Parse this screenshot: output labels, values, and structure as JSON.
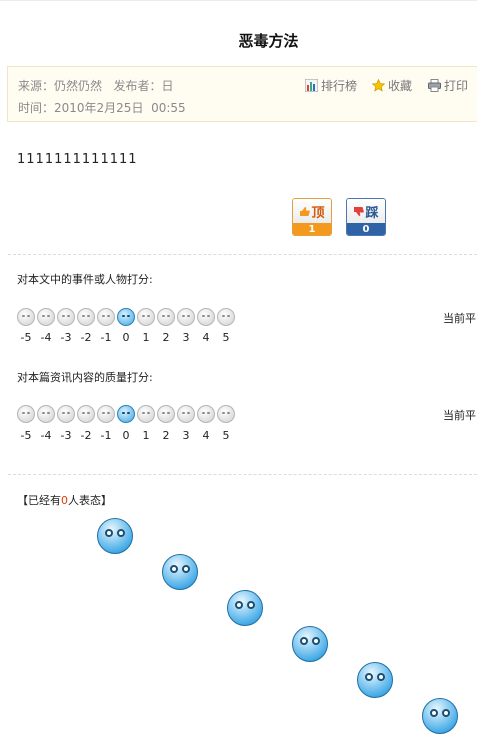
{
  "article": {
    "title": "恶毒方法",
    "meta_line1": "来源：仍然仍然   发布者：日",
    "meta_line2": "时间：2010年2月25日  00:55",
    "body": "1111111111111"
  },
  "tools": {
    "rank_label": "排行榜",
    "fav_label": "收藏",
    "print_label": "打印"
  },
  "votes": {
    "up_label": "顶",
    "up_count": "1",
    "down_label": "踩",
    "down_count": "0"
  },
  "rating": {
    "event_prompt": "对本文中的事件或人物打分:",
    "quality_prompt": "对本篇资讯内容的质量打分:",
    "current_label": "当前平",
    "scores": [
      "-5",
      "-4",
      "-3",
      "-2",
      "-1",
      "0",
      "1",
      "2",
      "3",
      "4",
      "5"
    ]
  },
  "mood": {
    "prefix": "【已经有",
    "count": "0",
    "suffix": "人表态】"
  },
  "colors": {
    "up_accent": "#f39a1e",
    "down_accent": "#2f63a6",
    "mood_count": "#e23c00",
    "selected_face": "#3fa5e0"
  },
  "icons": [
    "bar-chart-icon",
    "star-icon",
    "printer-icon",
    "thumbs-up-icon",
    "thumbs-down-icon",
    "face-icon"
  ]
}
